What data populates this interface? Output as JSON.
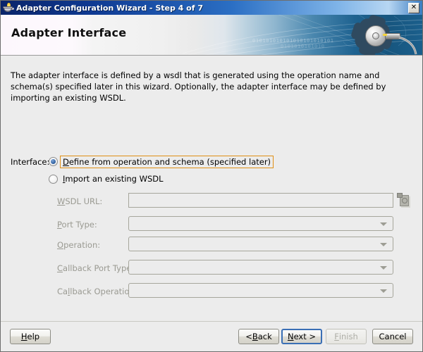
{
  "window": {
    "title": "Adapter Configuration Wizard - Step 4 of 7",
    "icon": "lamp-icon",
    "close_label": "✕"
  },
  "banner": {
    "heading": "Adapter Interface",
    "decor_binary_1": "010101010101010101010101",
    "decor_binary_2": "0101010101010",
    "gear_icon": "gear-icon"
  },
  "description": "The adapter interface is defined by a wsdl that is generated using the operation name and schema(s) specified later in this wizard.  Optionally, the adapter interface may be defined by importing an existing WSDL.",
  "interface": {
    "label": "Interface:",
    "options": [
      {
        "id": "define-from-operation",
        "label_pre": "D",
        "label_rest": "efine from operation and schema (specified later)",
        "selected": true,
        "focused": true
      },
      {
        "id": "import-existing-wsdl",
        "label_pre": "I",
        "label_rest": "mport an existing WSDL",
        "selected": false,
        "focused": false
      }
    ]
  },
  "fields": [
    {
      "id": "wsdl-url",
      "mnemonic_before": "",
      "mnemonic": "W",
      "label_rest": "SDL URL:",
      "type": "text",
      "value": "",
      "disabled": true,
      "has_browse": true,
      "browse_icon": "browse-wsdl-icon"
    },
    {
      "id": "port-type",
      "mnemonic_before": "",
      "mnemonic": "P",
      "label_rest": "ort Type:",
      "type": "combo",
      "value": "",
      "disabled": true,
      "has_browse": false
    },
    {
      "id": "operation",
      "mnemonic_before": "",
      "mnemonic": "O",
      "label_rest": "peration:",
      "type": "combo",
      "value": "",
      "disabled": true,
      "has_browse": false
    },
    {
      "id": "callback-port-type",
      "mnemonic_before": "",
      "mnemonic": "C",
      "label_rest": "allback Port Type:",
      "type": "combo",
      "value": "",
      "disabled": true,
      "has_browse": false
    },
    {
      "id": "callback-operation",
      "mnemonic_before": "Ca",
      "mnemonic": "l",
      "label_rest": "lback Operation:",
      "type": "combo",
      "value": "",
      "disabled": true,
      "has_browse": false
    }
  ],
  "footer": {
    "help": {
      "pre": "",
      "mnemonic": "H",
      "rest": "elp",
      "disabled": false,
      "focused": false
    },
    "back": {
      "pre": "< ",
      "mnemonic": "B",
      "rest": "ack",
      "disabled": false,
      "focused": false
    },
    "next": {
      "pre": "",
      "mnemonic": "N",
      "rest": "ext >",
      "disabled": false,
      "focused": true
    },
    "finish": {
      "pre": "",
      "mnemonic": "F",
      "rest": "inish",
      "disabled": true,
      "focused": false
    },
    "cancel": {
      "pre": "",
      "mnemonic": "C",
      "rest": "ancel",
      "disabled": false,
      "focused": false
    }
  },
  "colors": {
    "dialog_bg": "#ececec",
    "title_gradient_start": "#0a246a",
    "title_gradient_end": "#b7d6f2",
    "focus_orange": "#e08f15",
    "focus_blue": "#3a6fb5",
    "disabled_text": "#9a9a92"
  }
}
